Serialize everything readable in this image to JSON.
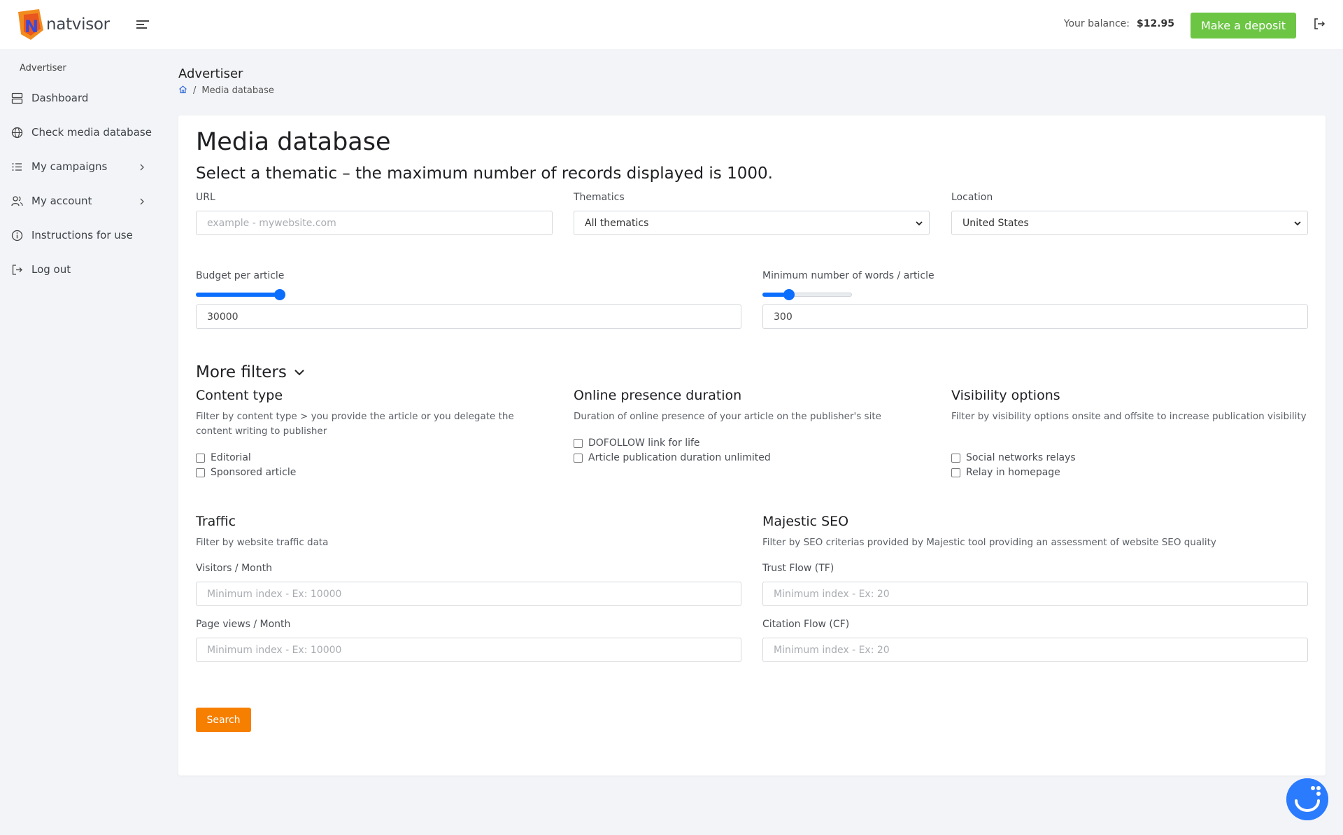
{
  "brand": {
    "name": "natvisor"
  },
  "topbar": {
    "balance_label": "Your balance:",
    "balance_value": "$12.95",
    "deposit_label": "Make a deposit"
  },
  "sidebar": {
    "heading": "Advertiser",
    "items": [
      {
        "label": "Dashboard",
        "icon": "server-icon"
      },
      {
        "label": "Check media database",
        "icon": "globe-icon"
      },
      {
        "label": "My campaigns",
        "icon": "list-icon"
      },
      {
        "label": "My account",
        "icon": "users-icon"
      },
      {
        "label": "Instructions for use",
        "icon": "info-icon"
      },
      {
        "label": "Log out",
        "icon": "logout-icon"
      }
    ]
  },
  "header": {
    "title": "Advertiser",
    "breadcrumb_current": "Media database"
  },
  "main": {
    "title": "Media database",
    "subtitle": "Select a thematic – the maximum number of records displayed is 1000.",
    "url": {
      "label": "URL",
      "placeholder": "example - mywebsite.com"
    },
    "thematics": {
      "label": "Thematics",
      "value": "All thematics"
    },
    "location": {
      "label": "Location",
      "value": "United States"
    },
    "budget": {
      "label": "Budget per article",
      "value": "30000",
      "slider_fraction": 1.0
    },
    "words": {
      "label": "Minimum number of words / article",
      "value": "300",
      "slider_fraction": 0.27
    },
    "more_filters": "More filters",
    "content_type": {
      "title": "Content type",
      "desc": "Filter by content type > you provide the article or you delegate the content writing to publisher",
      "options": [
        "Editorial",
        "Sponsored article"
      ]
    },
    "online_presence": {
      "title": "Online presence duration",
      "desc": "Duration of online presence of your article on the publisher's site",
      "options": [
        "DOFOLLOW link for life",
        "Article publication duration unlimited"
      ]
    },
    "visibility": {
      "title": "Visibility options",
      "desc": "Filter by visibility options onsite and offsite to increase publication visibility",
      "options": [
        "Social networks relays",
        "Relay in homepage"
      ]
    },
    "traffic": {
      "title": "Traffic",
      "desc": "Filter by website traffic data",
      "visitors_label": "Visitors / Month",
      "visitors_placeholder": "Minimum index - Ex: 10000",
      "pageviews_label": "Page views / Month",
      "pageviews_placeholder": "Minimum index - Ex: 10000"
    },
    "majestic": {
      "title": "Majestic SEO",
      "desc": "Filter by SEO criterias provided by Majestic tool providing an assessment of website SEO quality",
      "tf_label": "Trust Flow (TF)",
      "tf_placeholder": "Minimum index - Ex: 20",
      "cf_label": "Citation Flow (CF)",
      "cf_placeholder": "Minimum index - Ex: 20"
    },
    "search_label": "Search"
  },
  "colors": {
    "accent_green": "#6cc644",
    "accent_orange": "#f77f00",
    "slider_blue": "#0b6efd"
  }
}
